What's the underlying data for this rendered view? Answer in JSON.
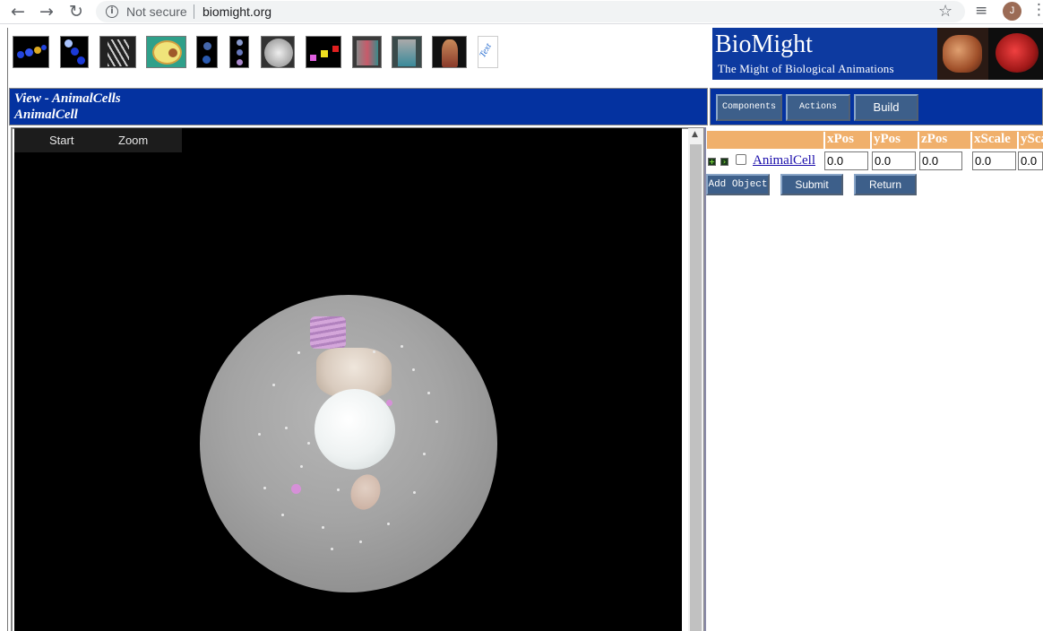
{
  "browser": {
    "security_label": "Not secure",
    "url": "biomight.org"
  },
  "profile": {
    "initial": "J"
  },
  "banner": {
    "title": "BioMight",
    "subtitle": "The Might of Biological Animations"
  },
  "thumbnails": {
    "text_label": "Text"
  },
  "view": {
    "line1": "View - AnimalCells",
    "line2": "AnimalCell"
  },
  "toolbar": {
    "components": "Components",
    "actions": "Actions",
    "build": "Build"
  },
  "viewer": {
    "start": "Start",
    "zoom": "Zoom"
  },
  "grid": {
    "columns": [
      "xPos",
      "yPos",
      "zPos",
      "xScale",
      "ySca"
    ],
    "row": {
      "name": "AnimalCell",
      "values": [
        "0.0",
        "0.0",
        "0.0",
        "0.0",
        "0.0"
      ]
    }
  },
  "form": {
    "add_object": "Add Object",
    "submit": "Submit",
    "return": "Return"
  },
  "colors": {
    "brand_blue": "#0432a0",
    "header_orange": "#f0b06c",
    "button_blue": "#3d5f8a"
  }
}
